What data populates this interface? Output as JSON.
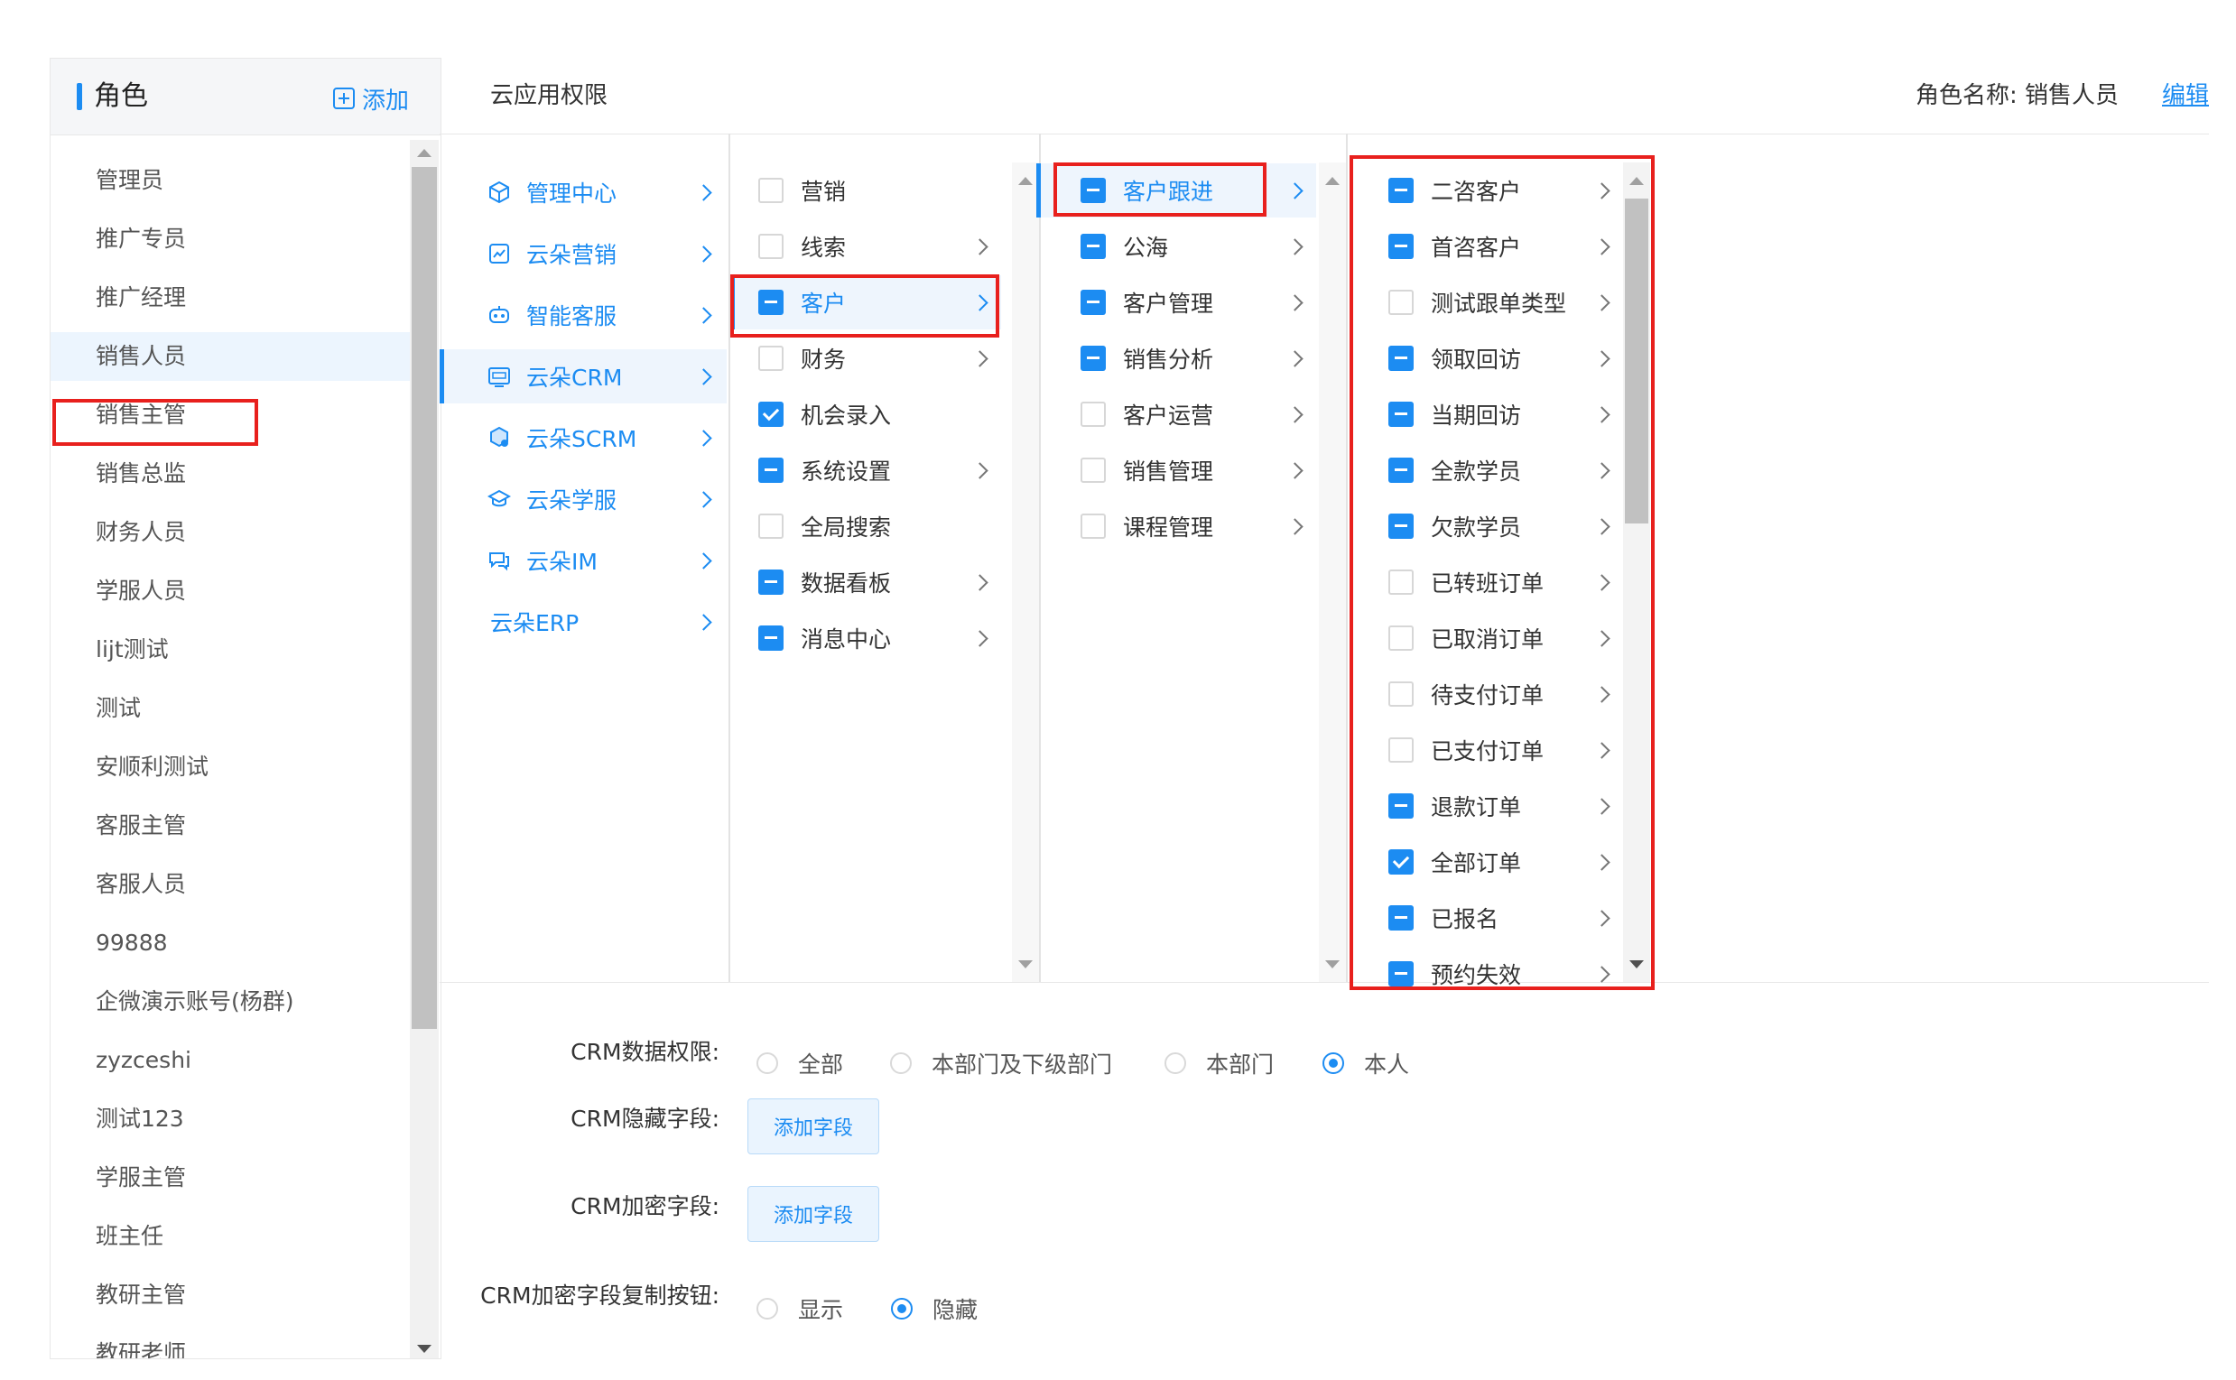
{
  "left_panel": {
    "title": "角色",
    "add_label": "添加",
    "roles": [
      "管理员",
      "推广专员",
      "推广经理",
      "销售人员",
      "销售主管",
      "销售总监",
      "财务人员",
      "学服人员",
      "lijt测试",
      "测试",
      "安顺利测试",
      "客服主管",
      "客服人员",
      "99888",
      "企微演示账号(杨群)",
      "zyzceshi",
      "测试123",
      "学服主管",
      "班主任",
      "教研主管",
      "教研老师"
    ],
    "selected_role": "销售人员"
  },
  "header": {
    "title": "云应用权限",
    "role_name_label": "角色名称: 销售人员",
    "edit_label": "编辑"
  },
  "apps": [
    {
      "label": "管理中心",
      "icon": "cube-icon"
    },
    {
      "label": "云朵营销",
      "icon": "marketing-icon"
    },
    {
      "label": "智能客服",
      "icon": "robot-icon"
    },
    {
      "label": "云朵CRM",
      "icon": "crm-icon",
      "active": true
    },
    {
      "label": "云朵SCRM",
      "icon": "scrm-icon"
    },
    {
      "label": "云朵学服",
      "icon": "graduation-cap-icon"
    },
    {
      "label": "云朵IM",
      "icon": "chat-icon"
    },
    {
      "label": "云朵ERP",
      "icon": ""
    }
  ],
  "modules": [
    {
      "label": "营销",
      "state": "none",
      "has_children": false
    },
    {
      "label": "线索",
      "state": "none",
      "has_children": true
    },
    {
      "label": "客户",
      "state": "partial",
      "has_children": true,
      "active": true
    },
    {
      "label": "财务",
      "state": "none",
      "has_children": true
    },
    {
      "label": "机会录入",
      "state": "checked",
      "has_children": false
    },
    {
      "label": "系统设置",
      "state": "partial",
      "has_children": true
    },
    {
      "label": "全局搜索",
      "state": "none",
      "has_children": false
    },
    {
      "label": "数据看板",
      "state": "partial",
      "has_children": true
    },
    {
      "label": "消息中心",
      "state": "partial",
      "has_children": true
    }
  ],
  "submodules": [
    {
      "label": "客户跟进",
      "state": "partial",
      "active": true
    },
    {
      "label": "公海",
      "state": "partial"
    },
    {
      "label": "客户管理",
      "state": "partial"
    },
    {
      "label": "销售分析",
      "state": "partial"
    },
    {
      "label": "客户运营",
      "state": "none"
    },
    {
      "label": "销售管理",
      "state": "none"
    },
    {
      "label": "课程管理",
      "state": "none"
    }
  ],
  "items": [
    {
      "label": "二咨客户",
      "state": "partial"
    },
    {
      "label": "首咨客户",
      "state": "partial"
    },
    {
      "label": "测试跟单类型",
      "state": "none"
    },
    {
      "label": "领取回访",
      "state": "partial"
    },
    {
      "label": "当期回访",
      "state": "partial"
    },
    {
      "label": "全款学员",
      "state": "partial"
    },
    {
      "label": "欠款学员",
      "state": "partial"
    },
    {
      "label": "已转班订单",
      "state": "none"
    },
    {
      "label": "已取消订单",
      "state": "none"
    },
    {
      "label": "待支付订单",
      "state": "none"
    },
    {
      "label": "已支付订单",
      "state": "none"
    },
    {
      "label": "退款订单",
      "state": "partial"
    },
    {
      "label": "全部订单",
      "state": "checked"
    },
    {
      "label": "已报名",
      "state": "partial"
    },
    {
      "label": "预约失效",
      "state": "partial"
    }
  ],
  "form": {
    "data_scope_label": "CRM数据权限:",
    "data_scope_options": [
      "全部",
      "本部门及下级部门",
      "本部门",
      "本人"
    ],
    "data_scope_selected": "本人",
    "hidden_fields_label": "CRM隐藏字段:",
    "encrypted_fields_label": "CRM加密字段:",
    "add_field_label": "添加字段",
    "copy_button_label": "CRM加密字段复制按钮:",
    "copy_button_options": [
      "显示",
      "隐藏"
    ],
    "copy_button_selected": "隐藏"
  },
  "colors": {
    "accent": "#1c8cf2",
    "highlight": "#e8201d"
  }
}
